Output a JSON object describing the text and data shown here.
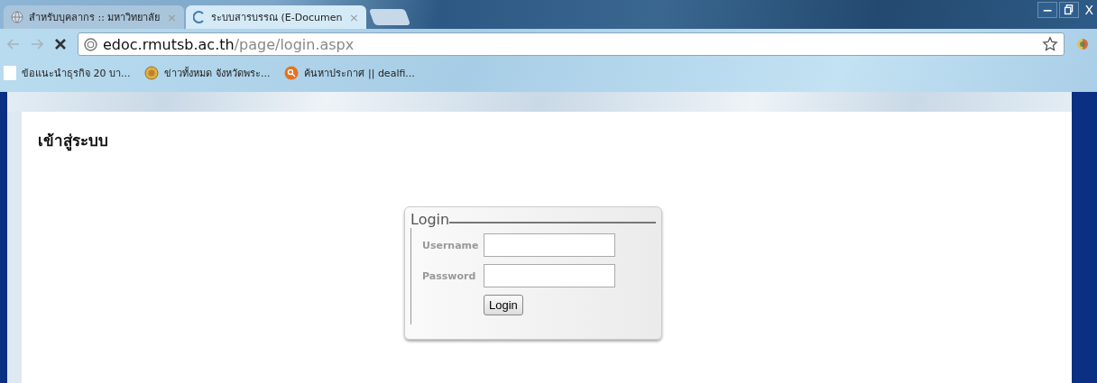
{
  "tabs": [
    {
      "title": "สำหรับบุคลากร :: มหาวิทยาลัย",
      "close": "×",
      "selected": false,
      "kind": "globe"
    },
    {
      "title": "ระบบสารบรรณ (E-Documen",
      "close": "×",
      "selected": true,
      "kind": "loading"
    }
  ],
  "window_controls": {
    "minimize": "−",
    "close": "X"
  },
  "address_bar": {
    "domain": "edoc.rmutsb.ac.th",
    "path": "/page/login.aspx"
  },
  "bookmarks": [
    {
      "label": "ข้อแนะนำธุรกิจ 20 บา...",
      "kind": "page"
    },
    {
      "label": "ข่าวทั้งหมด จังหวัดพระ...",
      "kind": "emblem"
    },
    {
      "label": "ค้นหาประกาศ || dealfi...",
      "kind": "search"
    }
  ],
  "page": {
    "heading": "เข้าสู่ระบบ"
  },
  "login": {
    "legend": "Login",
    "fields": [
      {
        "label": "Username"
      },
      {
        "label": "Password"
      }
    ],
    "button": "Login"
  }
}
